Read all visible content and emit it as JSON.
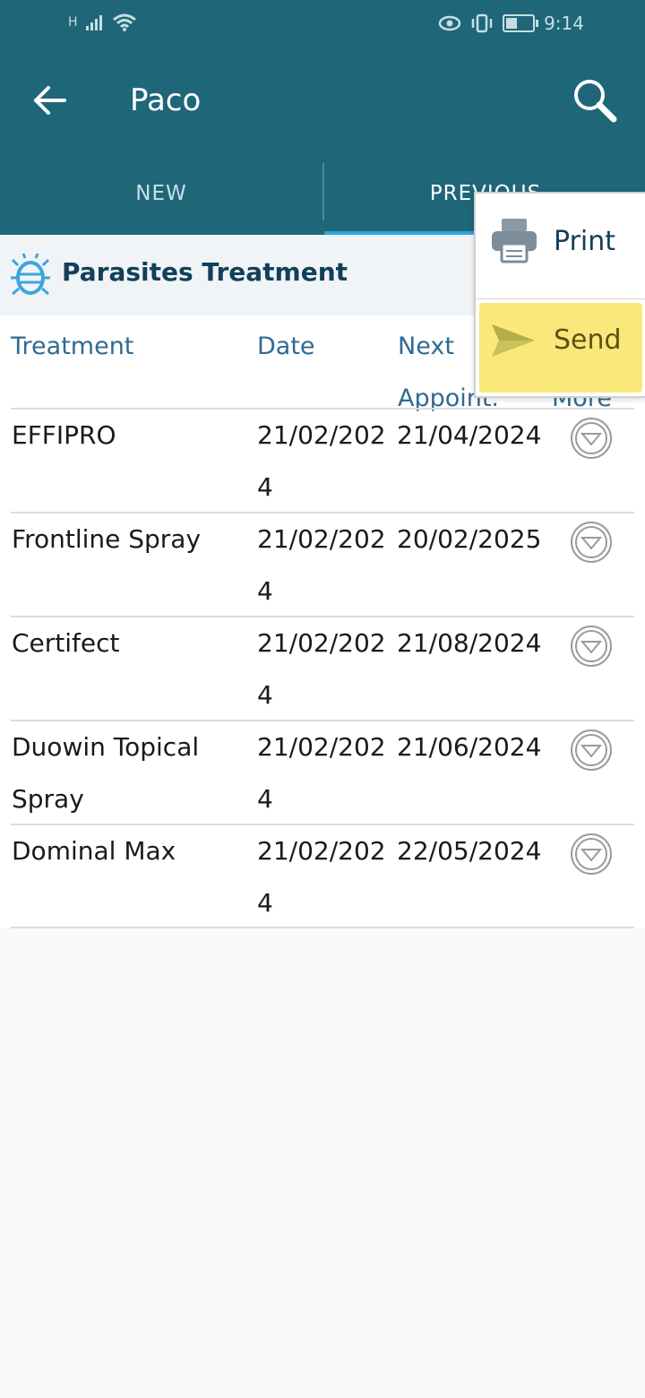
{
  "status": {
    "network": "H",
    "time": "9:14"
  },
  "header": {
    "title": "Paco",
    "back_icon": "arrow-left-icon",
    "search_icon": "search-icon"
  },
  "tabs": [
    {
      "label": "NEW"
    },
    {
      "label": "PREVIOUS"
    }
  ],
  "section": {
    "title": "Parasites Treatment",
    "icon": "bug-icon"
  },
  "table": {
    "headers": {
      "treatment": "Treatment",
      "date": "Date",
      "next_line1": "Next",
      "next_line2": "Appoint.",
      "more": "More"
    },
    "rows": [
      {
        "treatment": "EFFIPRO",
        "date": "21/02/2024",
        "next": "21/04/2024"
      },
      {
        "treatment": "Frontline Spray",
        "date": "21/02/2024",
        "next": "20/02/2025"
      },
      {
        "treatment": "Certifect",
        "date": "21/02/2024",
        "next": "21/08/2024"
      },
      {
        "treatment": "Duowin Topical Spray",
        "date": "21/02/2024",
        "next": "21/06/2024"
      },
      {
        "treatment": "Dominal Max",
        "date": "21/02/2024",
        "next": "22/05/2024"
      }
    ]
  },
  "menu": {
    "print": "Print",
    "send": "Send"
  },
  "colors": {
    "appbar": "#1f6679",
    "accent": "#2aa6de",
    "highlight": "#fbe87a"
  }
}
